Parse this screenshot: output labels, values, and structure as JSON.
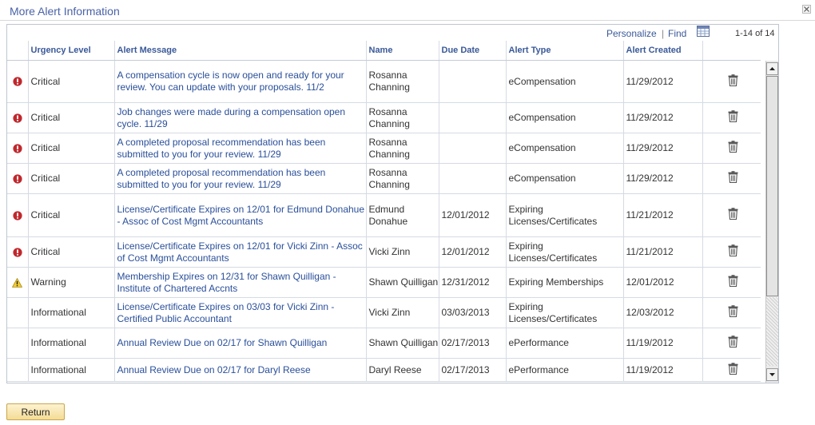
{
  "header": {
    "title": "More Alert Information"
  },
  "toolbar": {
    "personalize": "Personalize",
    "separator": "|",
    "find": "Find",
    "count": "1-14 of 14"
  },
  "columns": {
    "urgency": "Urgency Level",
    "message": "Alert Message",
    "name": "Name",
    "due": "Due Date",
    "type": "Alert Type",
    "created": "Alert Created"
  },
  "colors": {
    "critical": "#c0282d",
    "warning": "#f3cf2c",
    "link": "#2a4f9a",
    "header_text": "#3a5998"
  },
  "rows": [
    {
      "urgency": "Critical",
      "icon": "critical-icon",
      "message": "A compensation cycle is now open and ready for your review. You can update with your proposals. 11/2",
      "name": "Rosanna Channing",
      "due": "",
      "type": "eCompensation",
      "created": "11/29/2012"
    },
    {
      "urgency": "Critical",
      "icon": "critical-icon",
      "message": "Job changes were made during a compensation open cycle. 11/29",
      "name": "Rosanna Channing",
      "due": "",
      "type": "eCompensation",
      "created": "11/29/2012"
    },
    {
      "urgency": "Critical",
      "icon": "critical-icon",
      "message": "A completed proposal recommendation has been submitted to you for your review. 11/29",
      "name": "Rosanna Channing",
      "due": "",
      "type": "eCompensation",
      "created": "11/29/2012"
    },
    {
      "urgency": "Critical",
      "icon": "critical-icon",
      "message": "A completed proposal recommendation has been submitted to you for your review. 11/29",
      "name": "Rosanna Channing",
      "due": "",
      "type": "eCompensation",
      "created": "11/29/2012"
    },
    {
      "urgency": "Critical",
      "icon": "critical-icon",
      "message": "License/Certificate Expires on 12/01 for Edmund Donahue - Assoc of Cost Mgmt Accountants",
      "name": "Edmund Donahue",
      "due": "12/01/2012",
      "type": "Expiring Licenses/Certificates",
      "created": "11/21/2012"
    },
    {
      "urgency": "Critical",
      "icon": "critical-icon",
      "message": "License/Certificate Expires on 12/01 for Vicki Zinn - Assoc of Cost Mgmt Accountants",
      "name": "Vicki Zinn",
      "due": "12/01/2012",
      "type": "Expiring Licenses/Certificates",
      "created": "11/21/2012"
    },
    {
      "urgency": "Warning",
      "icon": "warning-icon",
      "message": "Membership Expires on 12/31 for Shawn Quilligan - Institute of Chartered Accnts",
      "name": "Shawn Quilligan",
      "due": "12/31/2012",
      "type": "Expiring Memberships",
      "created": "12/01/2012"
    },
    {
      "urgency": "Informational",
      "icon": "",
      "message": "License/Certificate Expires on 03/03 for Vicki Zinn - Certified Public Accountant",
      "name": "Vicki Zinn",
      "due": "03/03/2013",
      "type": "Expiring Licenses/Certificates",
      "created": "12/03/2012"
    },
    {
      "urgency": "Informational",
      "icon": "",
      "message": "Annual Review Due on 02/17 for Shawn Quilligan",
      "name": "Shawn Quilligan",
      "due": "02/17/2013",
      "type": "ePerformance",
      "created": "11/19/2012"
    },
    {
      "urgency": "Informational",
      "icon": "",
      "message": "Annual Review Due on 02/17 for Daryl Reese",
      "name": "Daryl Reese",
      "due": "02/17/2013",
      "type": "ePerformance",
      "created": "11/19/2012"
    }
  ],
  "footer": {
    "return_label": "Return"
  }
}
